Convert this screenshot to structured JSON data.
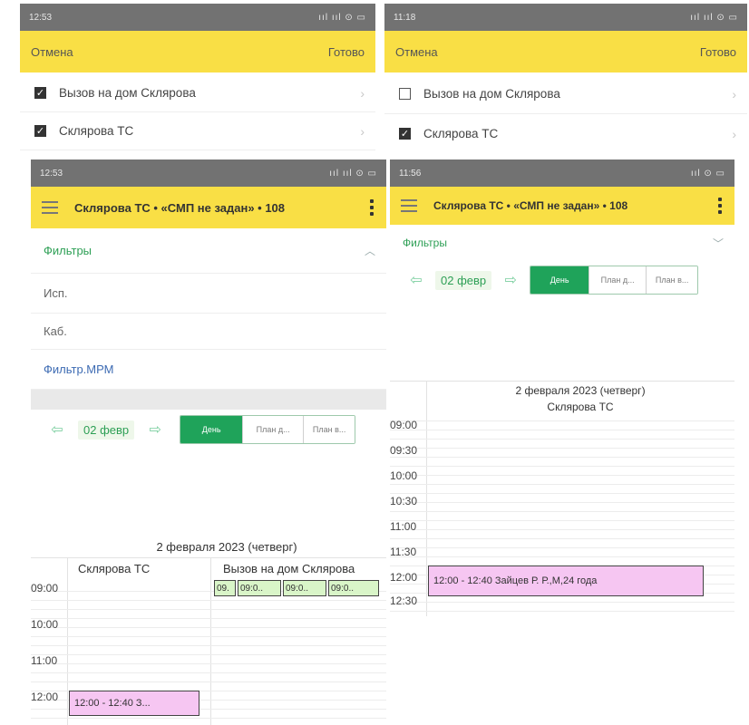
{
  "panel1": {
    "status_time": "12:53",
    "status_right": "ııl ııl ⊙ ▭",
    "cancel": "Отмена",
    "done": "Готово",
    "items": [
      {
        "label": "Вызов на дом Склярова",
        "checked": true
      },
      {
        "label": "Склярова ТС",
        "checked": true
      }
    ]
  },
  "panel2": {
    "status_time": "11:18",
    "status_right": "ııl ııl ⊙ ▭",
    "cancel": "Отмена",
    "done": "Готово",
    "items": [
      {
        "label": "Вызов на дом Склярова",
        "checked": false
      },
      {
        "label": "Склярова ТС",
        "checked": true
      }
    ]
  },
  "panel3": {
    "status_time": "12:53",
    "status_right": "ııl ııl ⊙ ▭",
    "title": "Склярова ТС • «СМП не задан» • 108",
    "filters_label": "Фильтры",
    "filter_fields": [
      "Исп.",
      "Каб."
    ],
    "filter_mpm": "Фильтр.МРМ",
    "date": "02 февр",
    "view_buttons": [
      "День",
      "План д...",
      "План в..."
    ],
    "cal_title": "2 февраля 2023 (четверг)",
    "columns": [
      "Склярова ТС",
      "Вызов на дом Склярова"
    ],
    "times": [
      "09:00",
      "10:00",
      "11:00",
      "12:00"
    ],
    "event": "12:00 - 12:40 З...",
    "green_slots": [
      "09.",
      "09:0..",
      "09:0..",
      "09:0.."
    ]
  },
  "panel4": {
    "status_time": "11:56",
    "status_right": "ııl ⊙ ▭",
    "title": "Склярова ТС • «СМП не задан» • 108",
    "filters_label": "Фильтры",
    "date": "02 февр",
    "view_buttons": [
      "День",
      "План д...",
      "План в..."
    ],
    "cal_title": "2 февраля 2023 (четверг)",
    "column": "Склярова ТС",
    "times": [
      "09:00",
      "09:30",
      "10:00",
      "10:30",
      "11:00",
      "11:30",
      "12:00",
      "12:30"
    ],
    "event": "12:00 - 12:40 Зайцев Р. Р.,М,24 года"
  }
}
